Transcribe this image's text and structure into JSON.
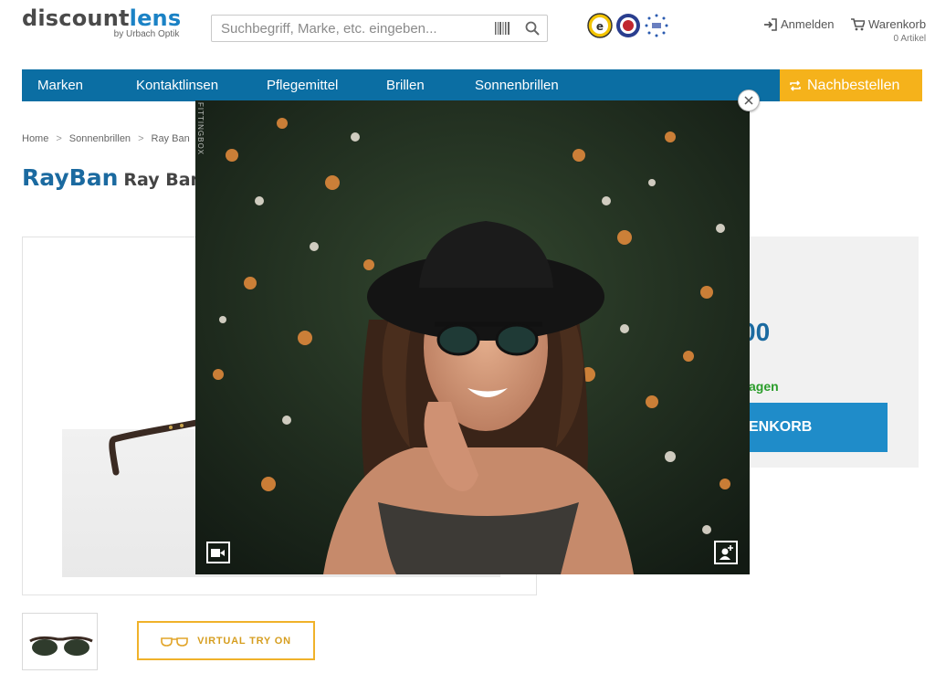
{
  "header": {
    "logo_main_a": "discount",
    "logo_main_b": "lens",
    "logo_sub": "by Urbach Optik",
    "search_placeholder": "Suchbegriff, Marke, etc. eingeben...",
    "login_label": "Anmelden",
    "cart_label": "Warenkorb",
    "cart_count": "0 Artikel"
  },
  "nav": {
    "items": [
      "Marken",
      "Kontaktlinsen",
      "Pflegemittel",
      "Brillen",
      "Sonnenbrillen"
    ],
    "reorder_label": "Nachbestellen"
  },
  "breadcrumb": [
    "Home",
    "Sonnenbrillen",
    "Ray Ban"
  ],
  "product": {
    "brand": "RayBan",
    "name": "Ray Ban",
    "price_partial": "00",
    "delivery_partial": "agen",
    "cart_button_partial": "ENKORB",
    "virtual_try_on": "VIRTUAL TRY ON"
  },
  "overlay": {
    "watermark": "FITTINGBOX"
  },
  "colors": {
    "nav_blue": "#0b6ea3",
    "brand_blue": "#1b82c5",
    "reorder_orange": "#f5b21b",
    "cart_button_blue": "#1f8cc9",
    "delivery_green": "#2a9d2a"
  },
  "icons": [
    "barcode-icon",
    "search-icon",
    "login-icon",
    "cart-icon",
    "refresh-icon",
    "close-icon",
    "video-camera-icon",
    "add-person-icon",
    "glasses-icon"
  ]
}
